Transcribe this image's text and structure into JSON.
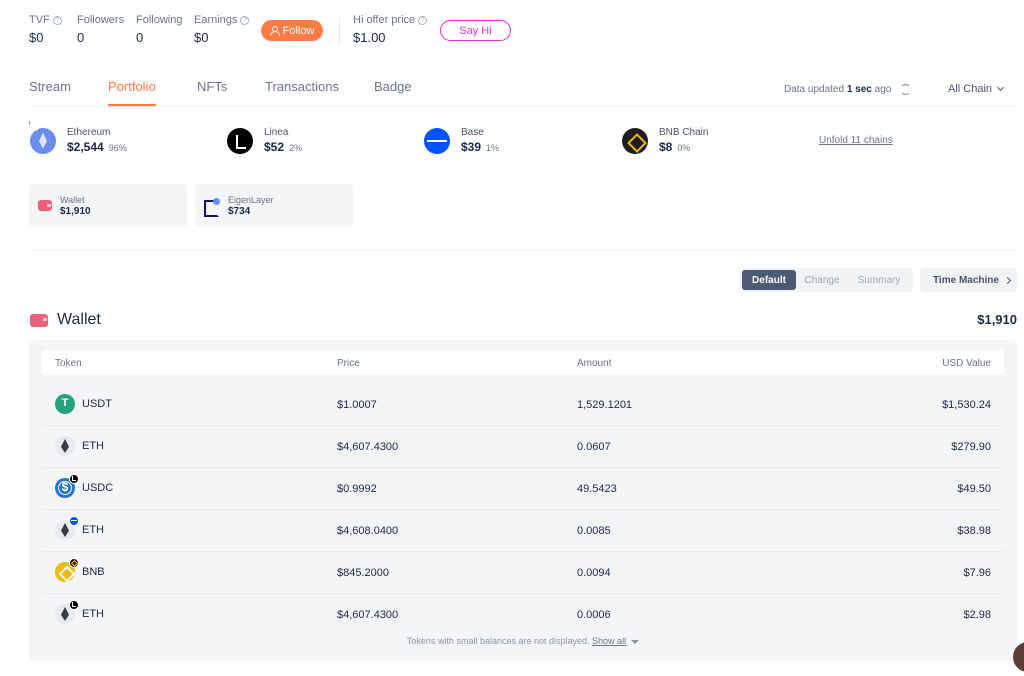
{
  "stats": [
    {
      "label": "TVF",
      "value": "$0",
      "has_help": true
    },
    {
      "label": "Followers",
      "value": "0",
      "has_help": false
    },
    {
      "label": "Following",
      "value": "0",
      "has_help": false
    },
    {
      "label": "Earnings",
      "value": "$0",
      "has_help": true
    }
  ],
  "follow_label": "Follow",
  "hi_offer": {
    "label": "Hi offer price",
    "value": "$1.00"
  },
  "say_hi_label": "Say Hi",
  "tabs": [
    "Stream",
    "Portfolio",
    "NFTs",
    "Transactions",
    "Badge"
  ],
  "active_tab": "Portfolio",
  "data_updated": {
    "prefix": "Data updated",
    "age": "1 sec",
    "suffix": "ago"
  },
  "chain_filter": "All Chain",
  "chains": [
    {
      "name": "Ethereum",
      "value": "$2,544",
      "pct": "96%",
      "icon": "ethereum-icon"
    },
    {
      "name": "Linea",
      "value": "$52",
      "pct": "2%",
      "icon": "linea-icon"
    },
    {
      "name": "Base",
      "value": "$39",
      "pct": "1%",
      "icon": "base-icon"
    },
    {
      "name": "BNB Chain",
      "value": "$8",
      "pct": "0%",
      "icon": "bnb-chain-icon"
    }
  ],
  "unfold_label": "Unfold 11 chains",
  "protocols": [
    {
      "name": "Wallet",
      "value": "$1,910",
      "icon": "wallet-icon"
    },
    {
      "name": "EigenLayer",
      "value": "$734",
      "icon": "eigenlayer-icon"
    }
  ],
  "view_options": [
    "Default",
    "Change",
    "Summary"
  ],
  "active_view": "Default",
  "time_machine_label": "Time Machine",
  "wallet": {
    "title": "Wallet",
    "total": "$1,910",
    "columns": [
      "Token",
      "Price",
      "Amount",
      "USD Value"
    ],
    "rows": [
      {
        "token": "USDT",
        "price": "$1.0007",
        "amount": "1,529.1201",
        "usd": "$1,530.24",
        "icon": "usdt-icon",
        "chain_badge": ""
      },
      {
        "token": "ETH",
        "price": "$4,607.4300",
        "amount": "0.0607",
        "usd": "$279.90",
        "icon": "eth-icon",
        "chain_badge": ""
      },
      {
        "token": "USDC",
        "price": "$0.9992",
        "amount": "49.5423",
        "usd": "$49.50",
        "icon": "usdc-icon",
        "chain_badge": "linea"
      },
      {
        "token": "ETH",
        "price": "$4,608.0400",
        "amount": "0.0085",
        "usd": "$38.98",
        "icon": "eth-icon",
        "chain_badge": "base"
      },
      {
        "token": "BNB",
        "price": "$845.2000",
        "amount": "0.0094",
        "usd": "$7.96",
        "icon": "bnb-icon",
        "chain_badge": "bnb"
      },
      {
        "token": "ETH",
        "price": "$4,607.4300",
        "amount": "0.0006",
        "usd": "$2.98",
        "icon": "eth-icon",
        "chain_badge": "linea"
      }
    ],
    "footnote": "Tokens with small balances are not displayed.",
    "show_all_label": "Show all"
  },
  "colors": {
    "accent": "#ff7a45",
    "say_hi": "#e12ed7",
    "active_view_bg": "#4d5a74",
    "text": "#192945"
  }
}
